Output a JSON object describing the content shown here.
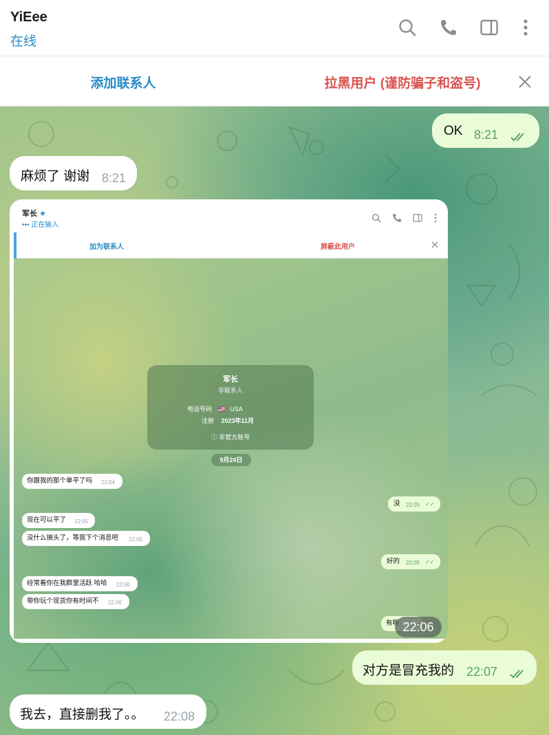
{
  "header": {
    "name": "YiEee",
    "status": "在线",
    "icons": [
      "search-icon",
      "phone-icon",
      "sidebar-icon",
      "more-icon"
    ]
  },
  "action_bar": {
    "add_contact": "添加联系人",
    "block_user": "拉黑用户 (谨防骗子和盗号)",
    "close_icon": "close-icon"
  },
  "messages": [
    {
      "dir": "out",
      "text": "OK",
      "time": "8:21",
      "read": true
    },
    {
      "dir": "in",
      "text": "麻烦了 谢谢",
      "time": "8:21"
    },
    {
      "dir": "out",
      "text": "对方是冒充我的",
      "time": "22:07",
      "read": true
    },
    {
      "dir": "in",
      "text": "我去，直接删我了。。",
      "time": "22:08"
    }
  ],
  "screenshot_message": {
    "overlay_time": "22:06",
    "inner": {
      "name": "军长",
      "status": "••• 正在输入",
      "add_contact": "加为联系人",
      "block_user": "屏蔽此用户",
      "card": {
        "name": "军长",
        "subtitle": "非联系人",
        "phone_label": "电话号码",
        "phone_value": "USA",
        "reg_label": "注册",
        "reg_value": "2023年11月",
        "note": "非官方账号"
      },
      "date": "9月24日",
      "messages": [
        {
          "dir": "in",
          "text": "你跟我的那个单平了吗",
          "time": "22:04"
        },
        {
          "dir": "out",
          "text": "没",
          "time": "22:05"
        },
        {
          "dir": "in",
          "text": "现在可以平了",
          "time": "22:05"
        },
        {
          "dir": "in",
          "text": "没什么搞头了，等我下个消息吧",
          "time": "22:05"
        },
        {
          "dir": "out",
          "text": "好的",
          "time": "22:05"
        },
        {
          "dir": "in",
          "text": "经常看你在我群里活跃 哈哈",
          "time": "22:06"
        },
        {
          "dir": "in",
          "text": "带你玩个现货你有时间不",
          "time": "22:06"
        },
        {
          "dir": "out",
          "text": "有啊",
          "time": ""
        }
      ]
    }
  },
  "colors": {
    "accent": "#2a8bc9",
    "danger": "#d9534f",
    "outgoing_bubble": "#eafbd7",
    "incoming_bubble": "#ffffff",
    "check": "#5aa35a"
  }
}
